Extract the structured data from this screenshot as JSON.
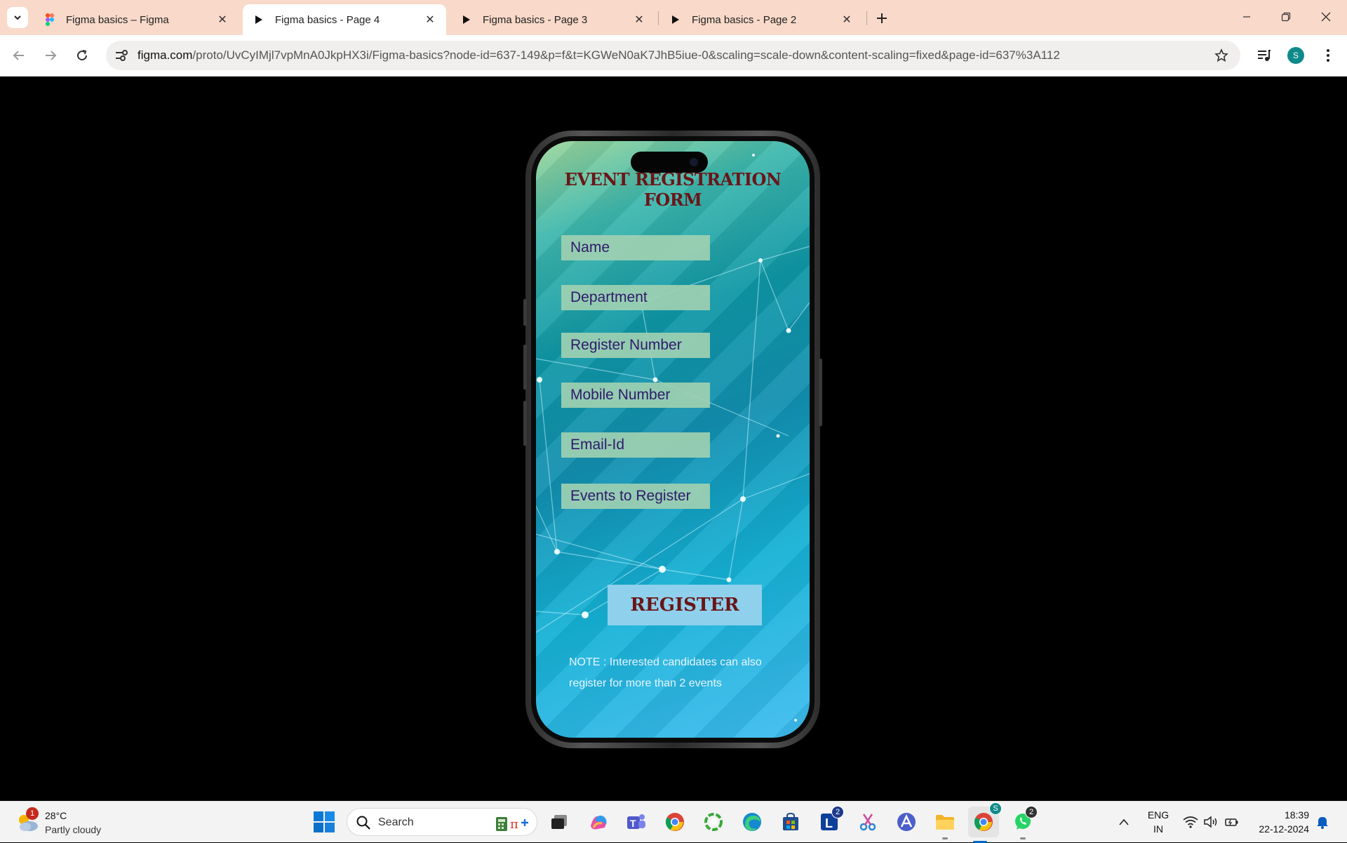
{
  "browser": {
    "tabs": [
      {
        "title": "Figma basics – Figma",
        "icon": "figma-logo-icon",
        "active": false
      },
      {
        "title": "Figma basics - Page 4",
        "icon": "play-icon",
        "active": true
      },
      {
        "title": "Figma basics - Page 3",
        "icon": "play-icon",
        "active": false
      },
      {
        "title": "Figma basics - Page 2",
        "icon": "play-icon",
        "active": false
      }
    ],
    "url_host": "figma.com",
    "url_path": "/proto/UvCyIMjl7vpMnA0JkpHX3i/Figma-basics?node-id=637-149&p=f&t=KGWeN0aK7JhB5iue-0&scaling=scale-down&content-scaling=fixed&page-id=637%3A112",
    "profile_initial": "S"
  },
  "form": {
    "title": "EVENT REGISTRATION FORM",
    "fields": [
      "Name",
      "Department",
      "Register Number",
      "Mobile Number",
      "Email-Id",
      "Events to Register"
    ],
    "submit_label": "REGISTER",
    "note_line1": "NOTE : Interested candidates can also",
    "note_line2": "register for more than 2 events"
  },
  "taskbar": {
    "weather_badge": "1",
    "temperature": "28°C",
    "condition": "Partly cloudy",
    "search_placeholder": "Search",
    "teams_badge": "2",
    "l_app_badge": "2",
    "chrome_profile_badge": "S",
    "whatsapp_badge": "2",
    "lang_line1": "ENG",
    "lang_line2": "IN",
    "time": "18:39",
    "date": "22-12-2024"
  },
  "colors": {
    "tabstrip": "#f9d9c9",
    "title_text": "#6a1517",
    "field_bg": "#9ed0b2",
    "field_text": "#2f1a6b",
    "register_bg": "#8fd0ec"
  }
}
